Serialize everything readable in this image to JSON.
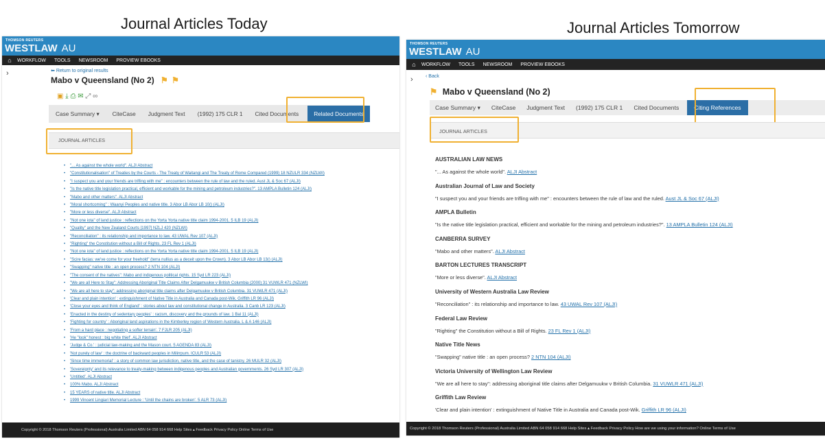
{
  "headings": {
    "today": "Journal Articles Today",
    "tomorrow": "Journal Articles Tomorrow"
  },
  "brand": {
    "company": "THOMSON REUTERS",
    "product": "WESTLAW",
    "region": "AU"
  },
  "nav": {
    "items": [
      "WORKFLOW",
      "TOOLS",
      "NEWSROOM",
      "PROVIEW EBOOKS"
    ]
  },
  "left": {
    "back_link": "Return to original results",
    "title": "Mabo v Queensland (No 2)",
    "tabs": [
      "Case Summary ▾",
      "CiteCase",
      "Judgment Text",
      "(1992) 175 CLR 1",
      "Cited Documents",
      "Related Documents"
    ],
    "section_label": "JOURNAL ARTICLES",
    "items": [
      "\"... As against the whole world\". ALJI Abstract",
      "\"Constitutionalisation\" of Treaties by the Courts - The Treaty of Waitangi and The Treaty of Rome Compared (1999) 18 NZULR 334 (NZLWI)",
      "\"I suspect you and your friends are trifling with me\" : encounters between the rule of law and the ruled. Aust JL & Soc 67 (ALJI)",
      "\"Is the native title legislation practical, efficient and workable for the mining and petroleum industries?\". 13 AMPLA Bulletin 124 (ALJI)",
      "\"Mabo and other matters\". ALJI Abstract",
      "\"Moral shortcoming\" : Waanyi Peoples and native title. 3 Abor LB Abor LB 10() (ALJI)",
      "\"More or less diverse\". ALJI Abstract",
      "\"Not one iota\" of land justice : reflections on the Yorta Yorta native title claim 1994-2001. 5 ILB 19 (ALJI)",
      "\"Quality\" and the New Zealand Courts [1997] NZLJ 420 (NZLWI)",
      "\"Reconciliation\" : its relationship and importance to law. 43 UWAL Rev 107 (ALJI)",
      "\"Righting\" the Constitution without a Bill of Rights. 23 FL Rev 1 (ALJI)",
      "\"Not one iota\" of land justice : reflections on the Yorta Yorta native title claim 1994-2001. 5 ILB 19 (ALJI)",
      "\"Scire facias: we've come for your freehold\" (terra nullius as a deceit upon the Crown). 3 Abor LB Abor LB 13() (ALJI)",
      "\"Swapping\" native title : an open process? 2 NTN 104 (ALJI)",
      "\"The consent of the natives\": Mabo and indigenous political rights. 15 Syd LR 223 (ALJI)",
      "\"We are all Here to Stay\": Addressing Aboriginal Title Claims After Delgamuukw v British Columbia (2000) 31 VUWLR 471 (NZLWI)",
      "\"We are all here to stay\": addressing aboriginal title claims after Delgamuukw v British Columbia. 31 VUWLR 471 (ALJI)",
      "'Clear and plain intention' : extinguishment of Native Title in Australia and Canada post-Wik. Griffith LR 96 (ALJI)",
      "'Close your eyes and think of England' : stories about law and constitutional change in Australia. 3 Canb LR 123 (ALJI)",
      "'Enacted in the destiny of sedentary peoples' : racism, discovery and the grounds of law. 1 Bal 11 (ALJI)",
      "'Fighting for country' : Aboriginal land aspirations in the Kimberley region of Western Australia. L & A 146 (ALJI)",
      "'From a hard place : negotiating a softer terrain'. 7 FJLR 205 (ALJI)",
      "'He \"look\" honest : big white thief'. ALJI Abstract",
      "'Judge & Co.' : judicial law-making and the Mason court. 5 AGENDA 83 (ALJI)",
      "'Not purely of law' : the doctrine of backward peoples in Milirrpum. ICULR 53 (ALJI)",
      "'Since time immemorial' : a story of common law jurisdiction, native title, and the case of tanistry. 26 MULR 32 (ALJI)",
      "'Sovereignty' and its relevance to treaty-making between indigenous peoples and Australian governments. 26 Syd LR 307 (ALJI)",
      "'Untitled'. ALJI Abstract",
      "100% Mabo. ALJI Abstract",
      "15 YEARS of native title. ALJI Abstract",
      "1999 Vincent Lingiari Memorial Lecture : 'Until the chains are broken'. 5 ALR 73 (ALJI)"
    ],
    "footer": "Copyright © 2018 Thomson Reuters (Professional) Australia Limited ABN 64 058 914 668    Help   Sites ▴   Feedback   Privacy Policy   Online Terms of Use"
  },
  "right": {
    "back_link": "Back",
    "title": "Mabo v Queensland (No 2)",
    "tabs": [
      "Case Summary ▾",
      "CiteCase",
      "Judgment Text",
      "(1992) 175 CLR 1",
      "Cited Documents",
      "Citing References"
    ],
    "section_label": "JOURNAL ARTICLES",
    "groups": [
      {
        "title": "AUSTRALIAN LAW NEWS",
        "text": "\"... As against the whole world\".",
        "link": "ALJI Abstract"
      },
      {
        "title": "Australian Journal of Law and Society",
        "text": "\"I suspect you and your friends are trifling with me\" : encounters between the rule of law and the ruled.",
        "link": "Aust JL & Soc 67 (ALJI)"
      },
      {
        "title": "AMPLA Bulletin",
        "text": "\"Is the native title legislation practical, efficient and workable for the mining and petroleum industries?\".",
        "link": "13 AMPLA Bulletin 124 (ALJI)"
      },
      {
        "title": "CANBERRA SURVEY",
        "text": "\"Mabo and other matters\".",
        "link": "ALJI Abstract"
      },
      {
        "title": "BARTON LECTURES TRANSCRIPT",
        "text": "\"More or less diverse\".",
        "link": "ALJI Abstract"
      },
      {
        "title": "University of Western Australia Law Review",
        "text": "\"Reconciliation\" : its relationship and importance to law.",
        "link": "43 UWAL Rev 107 (ALJI)"
      },
      {
        "title": "Federal Law Review",
        "text": "\"Righting\" the Constitution without a Bill of Rights.",
        "link": "23 FL Rev 1 (ALJI)"
      },
      {
        "title": "Native Title News",
        "text": "\"Swapping\" native title : an open process?",
        "link": "2 NTN 104 (ALJI)"
      },
      {
        "title": "Victoria University of Wellington Law Review",
        "text": "\"We are all here to stay\": addressing aboriginal title claims after Delgamuukw v British Columbia.",
        "link": "31 VUWLR 471 (ALJI)"
      },
      {
        "title": "Griffith Law Review",
        "text": "'Clear and plain intention' : extinguishment of Native Title in Australia and Canada post-Wik.",
        "link": "Griffith LR 96 (ALJI)"
      }
    ],
    "footer": "Copyright © 2018 Thomson Reuters (Professional) Australia Limited ABN 64 058 914 668    Help   Sites ▴   Feedback   Privacy Policy   How are we using your information?   Online Terms of Use"
  },
  "colors": {
    "brand_blue": "#2b87c2",
    "nav_dark": "#232323",
    "highlight": "#f0b030",
    "active_tab": "#2b6ea6",
    "link": "#1f6ea8"
  }
}
